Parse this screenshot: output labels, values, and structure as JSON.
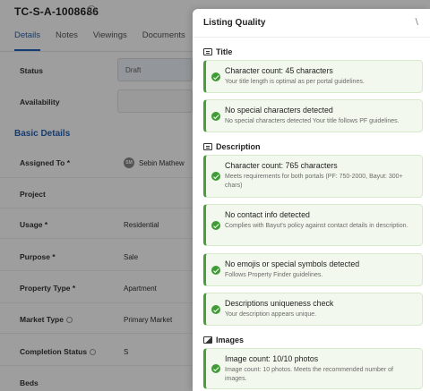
{
  "record": {
    "title": "TC-S-A-1008686",
    "title_icon": "info-icon",
    "tabs": [
      {
        "label": "Details",
        "active": true
      },
      {
        "label": "Notes",
        "active": false
      },
      {
        "label": "Viewings",
        "active": false
      },
      {
        "label": "Documents",
        "active": false
      }
    ],
    "fields": {
      "status": {
        "label": "Status",
        "value": "Draft"
      },
      "availability": {
        "label": "Availability",
        "value": ""
      },
      "section": "Basic Details",
      "assigned_to": {
        "label": "Assigned To *",
        "value": "Sebin Mathew",
        "initials": "SM"
      },
      "project": {
        "label": "Project",
        "value": ""
      },
      "usage": {
        "label": "Usage *",
        "value": "Residential"
      },
      "purpose": {
        "label": "Purpose *",
        "value": "Sale"
      },
      "property_type": {
        "label": "Property Type *",
        "value": "Apartment"
      },
      "market_type": {
        "label": "Market Type",
        "value": "Primary Market"
      },
      "completion_status": {
        "label": "Completion Status",
        "value": "S"
      },
      "beds": {
        "label": "Beds",
        "value": ""
      }
    }
  },
  "panel": {
    "title": "Listing Quality",
    "close_icon": "collapse-icon",
    "sections": {
      "title": {
        "heading": "Title",
        "icon": "text-icon",
        "checks": [
          {
            "title": "Character count: 45 characters",
            "desc": "Your title length is optimal as per portal guidelines.",
            "status": "pass"
          },
          {
            "title": "No special characters detected",
            "desc": "No special characters detected Your title follows PF guidelines.",
            "status": "pass"
          }
        ]
      },
      "description": {
        "heading": "Description",
        "icon": "text-icon",
        "checks": [
          {
            "title": "Character count: 765 characters",
            "desc": "Meets requirements for both portals (PF: 750-2000, Bayut: 300+ chars)",
            "status": "pass"
          },
          {
            "title": "No contact info detected",
            "desc": "Complies with Bayut's policy against contact details in description.",
            "status": "pass"
          },
          {
            "title": "No emojis or special symbols detected",
            "desc": "Follows Property Finder guidelines.",
            "status": "pass"
          },
          {
            "title": "Descriptions uniqueness check",
            "desc": "Your description appears unique.",
            "status": "pass"
          }
        ]
      },
      "images": {
        "heading": "Images",
        "icon": "image-icon",
        "checks": [
          {
            "title": "Image count: 10/10 photos",
            "desc": "Image count: 10 photos. Meets the recommended number of images.",
            "status": "pass"
          }
        ]
      }
    }
  },
  "colors": {
    "accent": "#2563b8",
    "pass_green": "#3f9c35",
    "card_bg": "#f2f8ee"
  }
}
